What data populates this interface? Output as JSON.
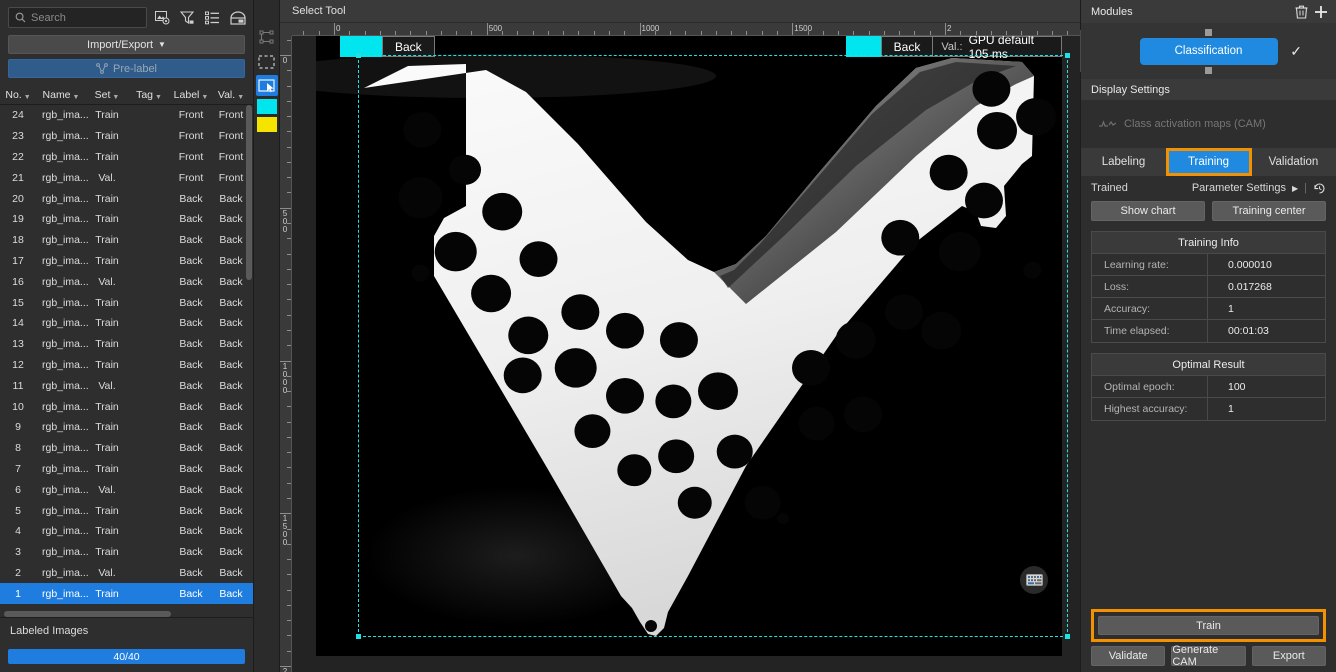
{
  "left": {
    "search": {
      "placeholder": "Search",
      "icon": "search-icon"
    },
    "header_icons": [
      "image-settings-icon",
      "filter-icon",
      "list-view-icon",
      "thumbnail-view-icon"
    ],
    "import_export_label": "Import/Export",
    "prelabel_label": "Pre-label",
    "columns": [
      "No.",
      "Name",
      "Set",
      "Tag",
      "Label",
      "Val."
    ],
    "rows": [
      {
        "no": "1",
        "name": "rgb_ima...",
        "set": "Train",
        "tag": "",
        "label": "Back",
        "val": "Back",
        "selected": true
      },
      {
        "no": "2",
        "name": "rgb_ima...",
        "set": "Val.",
        "tag": "",
        "label": "Back",
        "val": "Back"
      },
      {
        "no": "3",
        "name": "rgb_ima...",
        "set": "Train",
        "tag": "",
        "label": "Back",
        "val": "Back"
      },
      {
        "no": "4",
        "name": "rgb_ima...",
        "set": "Train",
        "tag": "",
        "label": "Back",
        "val": "Back"
      },
      {
        "no": "5",
        "name": "rgb_ima...",
        "set": "Train",
        "tag": "",
        "label": "Back",
        "val": "Back"
      },
      {
        "no": "6",
        "name": "rgb_ima...",
        "set": "Val.",
        "tag": "",
        "label": "Back",
        "val": "Back"
      },
      {
        "no": "7",
        "name": "rgb_ima...",
        "set": "Train",
        "tag": "",
        "label": "Back",
        "val": "Back"
      },
      {
        "no": "8",
        "name": "rgb_ima...",
        "set": "Train",
        "tag": "",
        "label": "Back",
        "val": "Back"
      },
      {
        "no": "9",
        "name": "rgb_ima...",
        "set": "Train",
        "tag": "",
        "label": "Back",
        "val": "Back"
      },
      {
        "no": "10",
        "name": "rgb_ima...",
        "set": "Train",
        "tag": "",
        "label": "Back",
        "val": "Back"
      },
      {
        "no": "11",
        "name": "rgb_ima...",
        "set": "Val.",
        "tag": "",
        "label": "Back",
        "val": "Back"
      },
      {
        "no": "12",
        "name": "rgb_ima...",
        "set": "Train",
        "tag": "",
        "label": "Back",
        "val": "Back"
      },
      {
        "no": "13",
        "name": "rgb_ima...",
        "set": "Train",
        "tag": "",
        "label": "Back",
        "val": "Back"
      },
      {
        "no": "14",
        "name": "rgb_ima...",
        "set": "Train",
        "tag": "",
        "label": "Back",
        "val": "Back"
      },
      {
        "no": "15",
        "name": "rgb_ima...",
        "set": "Train",
        "tag": "",
        "label": "Back",
        "val": "Back"
      },
      {
        "no": "16",
        "name": "rgb_ima...",
        "set": "Val.",
        "tag": "",
        "label": "Back",
        "val": "Back"
      },
      {
        "no": "17",
        "name": "rgb_ima...",
        "set": "Train",
        "tag": "",
        "label": "Back",
        "val": "Back"
      },
      {
        "no": "18",
        "name": "rgb_ima...",
        "set": "Train",
        "tag": "",
        "label": "Back",
        "val": "Back"
      },
      {
        "no": "19",
        "name": "rgb_ima...",
        "set": "Train",
        "tag": "",
        "label": "Back",
        "val": "Back"
      },
      {
        "no": "20",
        "name": "rgb_ima...",
        "set": "Train",
        "tag": "",
        "label": "Back",
        "val": "Back"
      },
      {
        "no": "21",
        "name": "rgb_ima...",
        "set": "Val.",
        "tag": "",
        "label": "Front",
        "val": "Front"
      },
      {
        "no": "22",
        "name": "rgb_ima...",
        "set": "Train",
        "tag": "",
        "label": "Front",
        "val": "Front"
      },
      {
        "no": "23",
        "name": "rgb_ima...",
        "set": "Train",
        "tag": "",
        "label": "Front",
        "val": "Front"
      },
      {
        "no": "24",
        "name": "rgb_ima...",
        "set": "Train",
        "tag": "",
        "label": "Front",
        "val": "Front"
      }
    ],
    "labeled_images_label": "Labeled Images",
    "progress_text": "40/40"
  },
  "toolstrip": {
    "tools": [
      "polygon-tool-icon",
      "rectangle-select-icon",
      "select-tool-icon"
    ],
    "swatch_colors": [
      "#00e5ee",
      "#f5e400"
    ]
  },
  "center": {
    "tool_title": "Select Tool",
    "ruler_h_labels": [
      "0",
      "500",
      "1000",
      "1500",
      "2"
    ],
    "ruler_v_labels": [
      "0",
      "500",
      "1000",
      "1500",
      "2"
    ],
    "label_chip": "Back",
    "result_chip": "Back",
    "val_key": "Val.:",
    "val_text": "GPU default 105 ms",
    "chip_color": "#00e5ee",
    "selection_color": "#1fe3e3",
    "keyboard_icon": "keyboard-shortcut-icon"
  },
  "right": {
    "header_title": "Modules",
    "header_icons": [
      "trash-icon",
      "plus-icon"
    ],
    "module_node_label": "Classification",
    "module_check_icon": "check-icon",
    "display_settings_label": "Display Settings",
    "cam_label": "Class activation maps (CAM)",
    "cam_icon": "cam-curve-icon",
    "tabs": [
      {
        "label": "Labeling",
        "active": false
      },
      {
        "label": "Training",
        "active": true
      },
      {
        "label": "Validation",
        "active": false
      }
    ],
    "highlight_color": "#f39100",
    "trained_label": "Trained",
    "parameter_settings_label": "Parameter Settings",
    "history_icon": "history-icon",
    "show_chart_label": "Show chart",
    "training_center_label": "Training center",
    "training_info": {
      "title": "Training Info",
      "rows": [
        {
          "key": "Learning rate:",
          "value": "0.000010"
        },
        {
          "key": "Loss:",
          "value": "0.017268"
        },
        {
          "key": "Accuracy:",
          "value": "1"
        },
        {
          "key": "Time elapsed:",
          "value": "00:01:03"
        }
      ]
    },
    "optimal_result": {
      "title": "Optimal Result",
      "rows": [
        {
          "key": "Optimal epoch:",
          "value": "100"
        },
        {
          "key": "Highest accuracy:",
          "value": "1"
        }
      ]
    },
    "train_label": "Train",
    "bottom_buttons": [
      "Validate",
      "Generate CAM",
      "Export"
    ]
  }
}
